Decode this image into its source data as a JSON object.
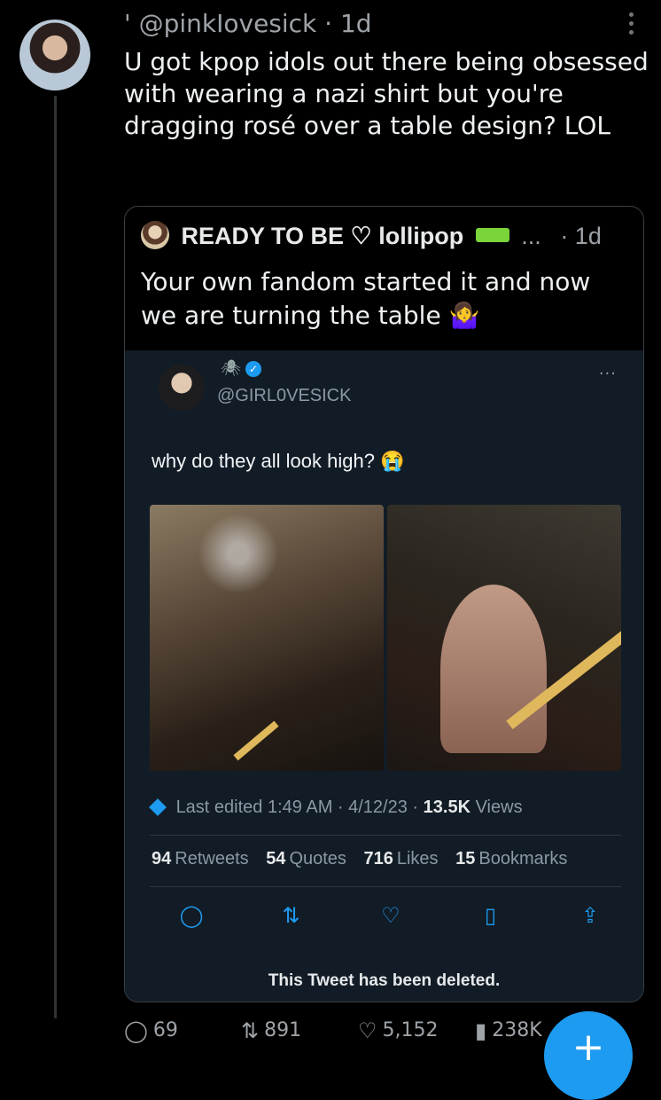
{
  "tweet": {
    "handle_line": "' @pinkIovesick · 1d",
    "text": "U got kpop idols out there being obsessed with wearing a nazi shirt but you're dragging rosé over a table design? LOL",
    "actions": {
      "replies": "69",
      "retweets": "891",
      "likes": "5,152",
      "views": "238K"
    }
  },
  "quote": {
    "name": "READY TO BE ♡ lollipop",
    "dots": "...",
    "time": "· 1d",
    "text": "Your own fandom started it and now we are turning the table 🤷‍♀️"
  },
  "screenshot": {
    "handle": "@GIRL0VESICK",
    "emoji": "🕷",
    "text": "why do they all look high? 😭",
    "edited": "Last edited 1:49 AM · 4/12/23 ·",
    "views_count": "13.5K",
    "views_label": "Views",
    "stats": [
      {
        "count": "94",
        "label": "Retweets"
      },
      {
        "count": "54",
        "label": "Quotes"
      },
      {
        "count": "716",
        "label": "Likes"
      },
      {
        "count": "15",
        "label": "Bookmarks"
      }
    ],
    "deleted_notice": "This Tweet has been deleted."
  },
  "icons": {
    "reply": "reply-icon",
    "retweet": "retweet-icon",
    "like": "like-icon",
    "views": "views-icon",
    "bookmark": "bookmark-icon",
    "share": "share-icon",
    "more": "more-icon",
    "compose": "compose-icon",
    "verified": "verified-badge-icon"
  },
  "colors": {
    "background": "#000000",
    "accent": "#1d9bf0",
    "muted": "#9ea3a8"
  }
}
